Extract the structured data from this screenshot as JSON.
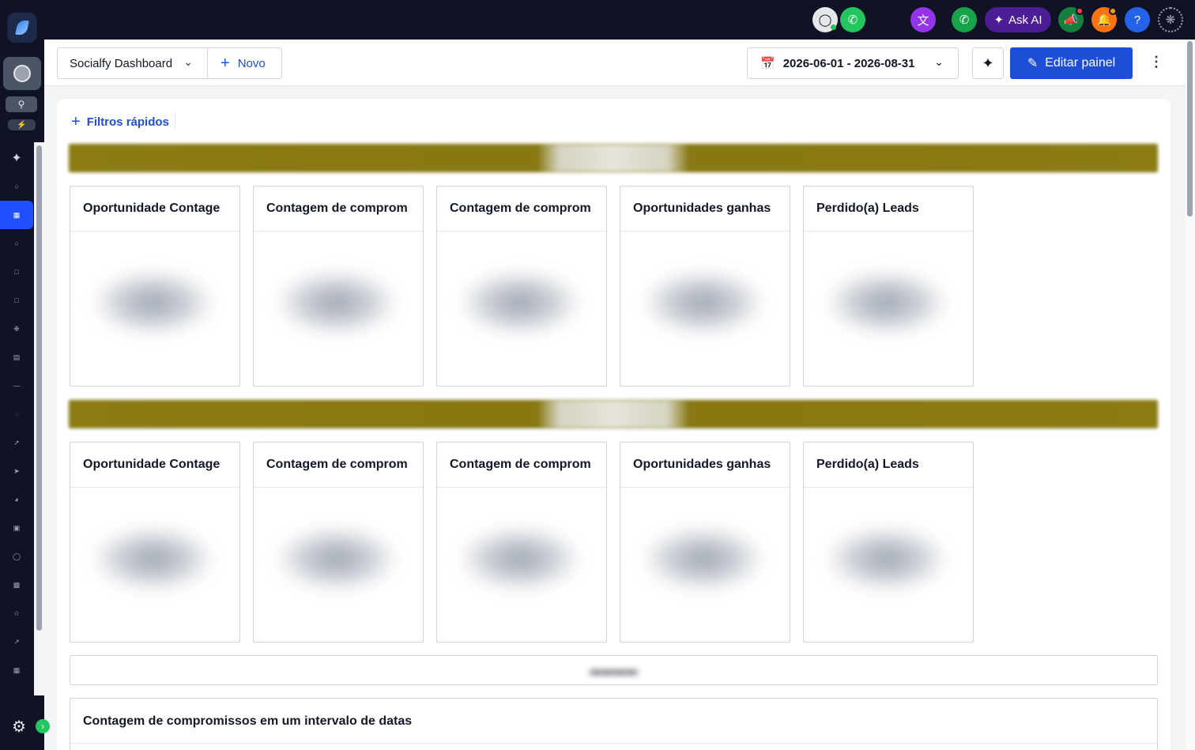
{
  "topbar": {
    "ask_ai_label": "Ask AI",
    "icons": [
      "chat-icon",
      "whatsapp-icon",
      "translate-icon",
      "phone-icon",
      "sparkle-icon",
      "megaphone-icon",
      "bell-icon",
      "help-icon",
      "organization-icon"
    ],
    "help_glyph": "?"
  },
  "toolbar": {
    "dashboard_name": "Socialfy Dashboard",
    "new_label": "Novo",
    "date_range": "2026-06-01 - 2026-08-31",
    "edit_label": "Editar painel"
  },
  "filters": {
    "quick_filters_label": "Filtros rápidos"
  },
  "sections": [
    {
      "cards": [
        {
          "title": "Oportunidade Contage"
        },
        {
          "title": "Contagem de comprom"
        },
        {
          "title": "Contagem de comprom"
        },
        {
          "title": "Oportunidades ganhas"
        },
        {
          "title": "Perdido(a) Leads"
        }
      ]
    },
    {
      "cards": [
        {
          "title": "Oportunidade Contage"
        },
        {
          "title": "Contagem de comprom"
        },
        {
          "title": "Contagem de comprom"
        },
        {
          "title": "Oportunidades ganhas"
        },
        {
          "title": "Perdido(a) Leads"
        }
      ]
    }
  ],
  "wide_card": {
    "title": "Contagem de compromissos em um intervalo de datas"
  },
  "colors": {
    "sidebar_bg": "#0f1324",
    "accent_blue": "#1d4ed8",
    "active_nav": "#1f4fff",
    "section_bar": "#8a7b13"
  }
}
